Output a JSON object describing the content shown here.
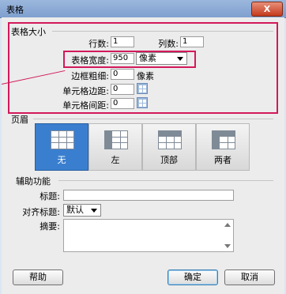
{
  "window": {
    "title": "表格",
    "close_label": "X"
  },
  "table_size": {
    "section_label": "表格大小",
    "rows_label": "行数:",
    "rows_value": "1",
    "cols_label": "列数:",
    "cols_value": "1",
    "width_label": "表格宽度:",
    "width_value": "950",
    "width_unit": "像素",
    "border_label": "边框粗细:",
    "border_value": "0",
    "border_unit": "像素",
    "padding_label": "单元格边距:",
    "padding_value": "0",
    "spacing_label": "单元格间距:",
    "spacing_value": "0"
  },
  "header": {
    "section_label": "页眉",
    "options": [
      {
        "label": "无",
        "selected": true
      },
      {
        "label": "左",
        "selected": false
      },
      {
        "label": "顶部",
        "selected": false
      },
      {
        "label": "两者",
        "selected": false
      }
    ]
  },
  "accessibility": {
    "section_label": "辅助功能",
    "caption_label": "标题:",
    "caption_value": "",
    "align_label": "对齐标题:",
    "align_value": "默认",
    "summary_label": "摘要:",
    "summary_value": ""
  },
  "buttons": {
    "help": "帮助",
    "ok": "确定",
    "cancel": "取消"
  },
  "colors": {
    "highlight": "#d2195a",
    "selected_tile": "#3a7fcf",
    "titlebar": "#7f9fcf"
  }
}
